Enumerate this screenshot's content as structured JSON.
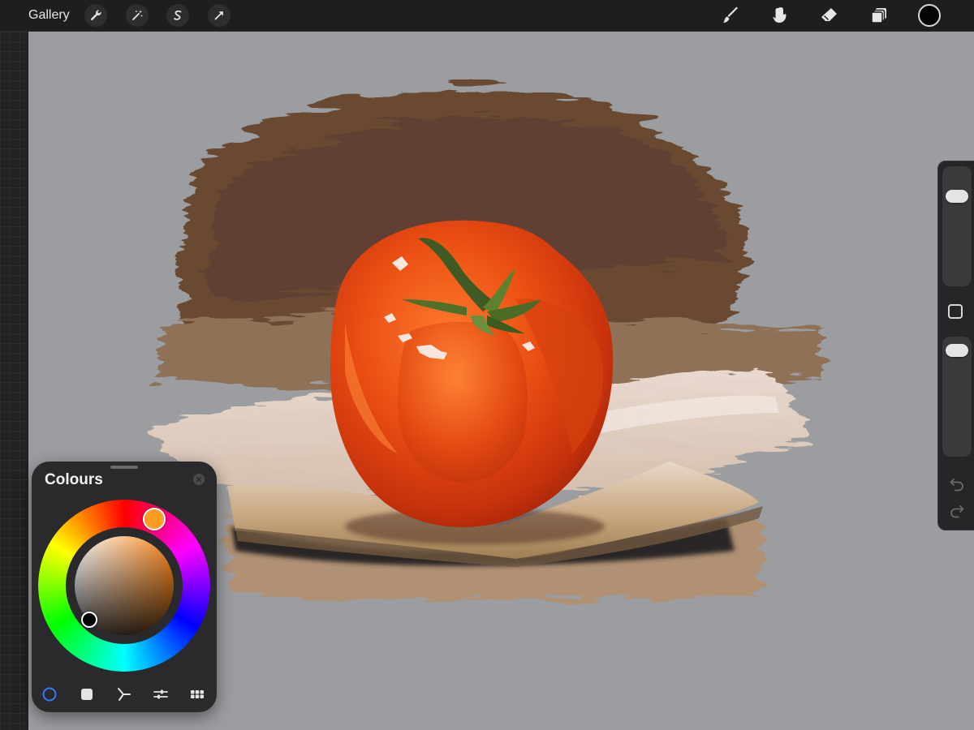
{
  "topbar": {
    "gallery_label": "Gallery",
    "left_tools": [
      "wrench-icon",
      "magic-wand-icon",
      "selection-icon",
      "transform-icon"
    ],
    "right_tools": [
      "brush-icon",
      "smudge-icon",
      "eraser-icon",
      "layers-icon"
    ],
    "current_color": "#050505"
  },
  "sidebar": {
    "size_slider_level": 0.2,
    "opacity_slider_level": 0.04,
    "controls": [
      "modifier-button",
      "undo-icon",
      "redo-icon"
    ]
  },
  "colour_panel": {
    "title": "Colours",
    "mode_tabs": [
      "disc-icon",
      "classic-icon",
      "harmony-icon",
      "value-icon",
      "palettes-icon"
    ],
    "active_mode": "disc-icon",
    "selected_hue": "#ff9a22",
    "selected_color": "#050505",
    "active_tab_color": "#2f7cf6"
  },
  "canvas": {
    "background": "#9c9da0",
    "subject": "tomato-painting"
  }
}
